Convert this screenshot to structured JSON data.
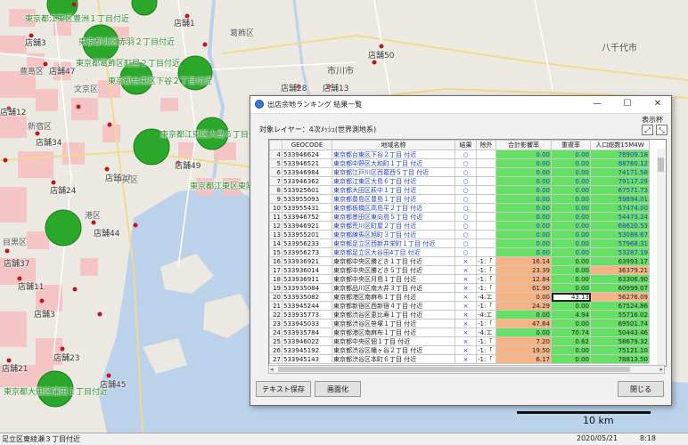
{
  "map": {
    "green_labels": [
      "東京都江東区豊洲１丁目付近",
      "東京都北区赤羽２丁目付近",
      "東京都葛飾区町屋２丁目付近",
      "東京都台東区下谷２丁目付近",
      "東京都江東区大島６丁目付近",
      "東京都江東区東陽３丁目付近",
      "東京都大田区蒲田１丁目付近"
    ],
    "store_labels": [
      "店舗3",
      "店舗1",
      "店舗50",
      "店舗28",
      "店舗13",
      "店舗12",
      "店舗47",
      "店舗49",
      "店舗34",
      "店舗44",
      "店舗37",
      "店舗11",
      "店舗3",
      "店舗23",
      "店舗45",
      "店舗21",
      "店舗27",
      "店舗24"
    ],
    "ward_labels": [
      "葛飾区",
      "豊島区",
      "文京区",
      "新宿区",
      "中央区",
      "港区",
      "目黒区",
      "市川市",
      "八千代市"
    ]
  },
  "scale": {
    "label": "10 km"
  },
  "statusbar": {
    "location": "足立区東綾瀬３丁目付近",
    "date": "2020/05/21",
    "time": "8:18"
  },
  "dialog": {
    "title": "出店余地ランキング 結果一覧",
    "layer_info": "対象レイヤー：4次ﾒｯｼｭ(世界測地系)",
    "display_label": "表示杯",
    "columns": [
      "",
      "GEOCODE",
      "地域名称",
      "結果",
      "除外",
      "合計影響率",
      "重複率",
      "人口総数15M4W"
    ],
    "rows": [
      {
        "no": "4",
        "geo": "533946624",
        "name": "東京都台東区下谷２丁目 付近",
        "res": "○",
        "ex": "",
        "imp": "0.00",
        "dup": "0.00",
        "pop": "78909.18",
        "c": "g"
      },
      {
        "no": "5",
        "geo": "533946521",
        "name": "東京都中野区大和町１丁目 付近",
        "res": "○",
        "ex": "",
        "imp": "0.00",
        "dup": "0.00",
        "pop": "68760.12",
        "c": "g"
      },
      {
        "no": "6",
        "geo": "533946984",
        "name": "東京都江戸川区西葛西５丁目 付近",
        "res": "○",
        "ex": "",
        "imp": "0.00",
        "dup": "0.00",
        "pop": "74171.58",
        "c": "g"
      },
      {
        "no": "7",
        "geo": "533946362",
        "name": "東京都江東区大島６丁目 付近",
        "res": "○",
        "ex": "",
        "imp": "0.00",
        "dup": "0.00",
        "pop": "79117.29",
        "c": "g"
      },
      {
        "no": "8",
        "geo": "533925601",
        "name": "東京都大田区萩中１丁目 付近",
        "res": "○",
        "ex": "",
        "imp": "0.00",
        "dup": "0.00",
        "pop": "67571.73",
        "c": "g"
      },
      {
        "no": "9",
        "geo": "533955093",
        "name": "東京都豊島区豊島１丁目 付近",
        "res": "○",
        "ex": "",
        "imp": "0.00",
        "dup": "0.00",
        "pop": "59694.01",
        "c": "g"
      },
      {
        "no": "10",
        "geo": "533955431",
        "name": "東京都板橋区高島平２丁目 付近",
        "res": "○",
        "ex": "",
        "imp": "0.00",
        "dup": "0.00",
        "pop": "57474.00",
        "c": "g"
      },
      {
        "no": "11",
        "geo": "533946752",
        "name": "東京都墨田区東向島５丁目 付近",
        "res": "○",
        "ex": "",
        "imp": "0.00",
        "dup": "0.00",
        "pop": "54473.24",
        "c": "g"
      },
      {
        "no": "12",
        "geo": "533946921",
        "name": "東京都荒川区町屋２丁目 付近",
        "res": "○",
        "ex": "",
        "imp": "0.00",
        "dup": "0.00",
        "pop": "68620.53",
        "c": "g"
      },
      {
        "no": "13",
        "geo": "533955201",
        "name": "東京都練馬区旭町３丁目 付近",
        "res": "○",
        "ex": "",
        "imp": "0.00",
        "dup": "0.00",
        "pop": "53088.67",
        "c": "g"
      },
      {
        "no": "14",
        "geo": "533956233",
        "name": "東京都足立区西新井栄町１丁目 付近",
        "res": "○",
        "ex": "",
        "imp": "0.00",
        "dup": "0.00",
        "pop": "57968.31",
        "c": "g"
      },
      {
        "no": "15",
        "geo": "533956273",
        "name": "東京都足立区大谷田4丁目 付近",
        "res": "○",
        "ex": "",
        "imp": "0.00",
        "dup": "0.00",
        "pop": "53287.19",
        "c": "g"
      },
      {
        "no": "16",
        "geo": "533936921",
        "name": "東京都中央区勝どき１丁目 付近",
        "res": "×",
        "ex": "-1:「",
        "imp": "16.14",
        "dup": "0.00",
        "pop": "63993.17",
        "c": "o"
      },
      {
        "no": "17",
        "geo": "533936014",
        "name": "東京都中央区勝どき５丁目 付近",
        "res": "×",
        "ex": "-1:「",
        "imp": "23.39",
        "dup": "0.00",
        "pop": "36379.21",
        "c": "o"
      },
      {
        "no": "18",
        "geo": "533936911",
        "name": "東京都中央区月島１丁目 付近",
        "res": "×",
        "ex": "-1:「",
        "imp": "12.84",
        "dup": "0.00",
        "pop": "63306.90",
        "c": "o"
      },
      {
        "no": "19",
        "geo": "533935084",
        "name": "東京都品川区南大井３丁目 付近",
        "res": "×",
        "ex": "-1:「",
        "imp": "61.90",
        "dup": "0.00",
        "pop": "60999.07",
        "c": "o"
      },
      {
        "no": "20",
        "geo": "533935082",
        "name": "東京都港区南麻布１丁目 付近",
        "res": "×",
        "ex": "-4:エ",
        "imp": "0.00",
        "dup": "43.13",
        "pop": "56276.09",
        "c": "s"
      },
      {
        "no": "21",
        "geo": "533945244",
        "name": "東京都新宿区西新宿４丁目 付近",
        "res": "×",
        "ex": "-1:「",
        "imp": "24.29",
        "dup": "0.00",
        "pop": "67524.86",
        "c": "o"
      },
      {
        "no": "22",
        "geo": "533935773",
        "name": "東京都渋谷区恵比寿１丁目 付近",
        "res": "×",
        "ex": "-4:エ",
        "imp": "0.00",
        "dup": "4.94",
        "pop": "55716.02",
        "c": "g"
      },
      {
        "no": "23",
        "geo": "533945033",
        "name": "東京都渋谷区笹塚１丁目 付近",
        "res": "×",
        "ex": "-1:「",
        "imp": "47.64",
        "dup": "0.00",
        "pop": "69501.74",
        "c": "o"
      },
      {
        "no": "24",
        "geo": "533935784",
        "name": "東京都港区南麻布１丁目 付近",
        "res": "×",
        "ex": "-4:エ",
        "imp": "0.00",
        "dup": "70.74",
        "pop": "50443.46",
        "c": "g"
      },
      {
        "no": "25",
        "geo": "533946022",
        "name": "東京都中央区佃１丁目 付近",
        "res": "×",
        "ex": "-1:「",
        "imp": "7.20",
        "dup": "0.62",
        "pop": "58679.32",
        "c": "o"
      },
      {
        "no": "26",
        "geo": "533945192",
        "name": "東京都渋谷区幡ヶ谷２丁目 付近",
        "res": "×",
        "ex": "-1:「",
        "imp": "19.50",
        "dup": "0.00",
        "pop": "75121.10",
        "c": "o"
      },
      {
        "no": "27",
        "geo": "533945143",
        "name": "東京都渋谷区本町６丁目 付近",
        "res": "×",
        "ex": "-1:「",
        "imp": "6.17",
        "dup": "0.00",
        "pop": "78813.50",
        "c": "o"
      }
    ],
    "buttons": {
      "text_save": "テキスト保存",
      "screen": "画面化",
      "close": "閉じる"
    },
    "window_controls": {
      "minimize": "—",
      "maximize": "☐",
      "close": "✕"
    }
  },
  "colors": {
    "good": "#66e064",
    "bad": "#f6b384",
    "green_circle": "#2ba82b",
    "store_dot": "#c0141e",
    "heat": "#f7c1c1"
  }
}
